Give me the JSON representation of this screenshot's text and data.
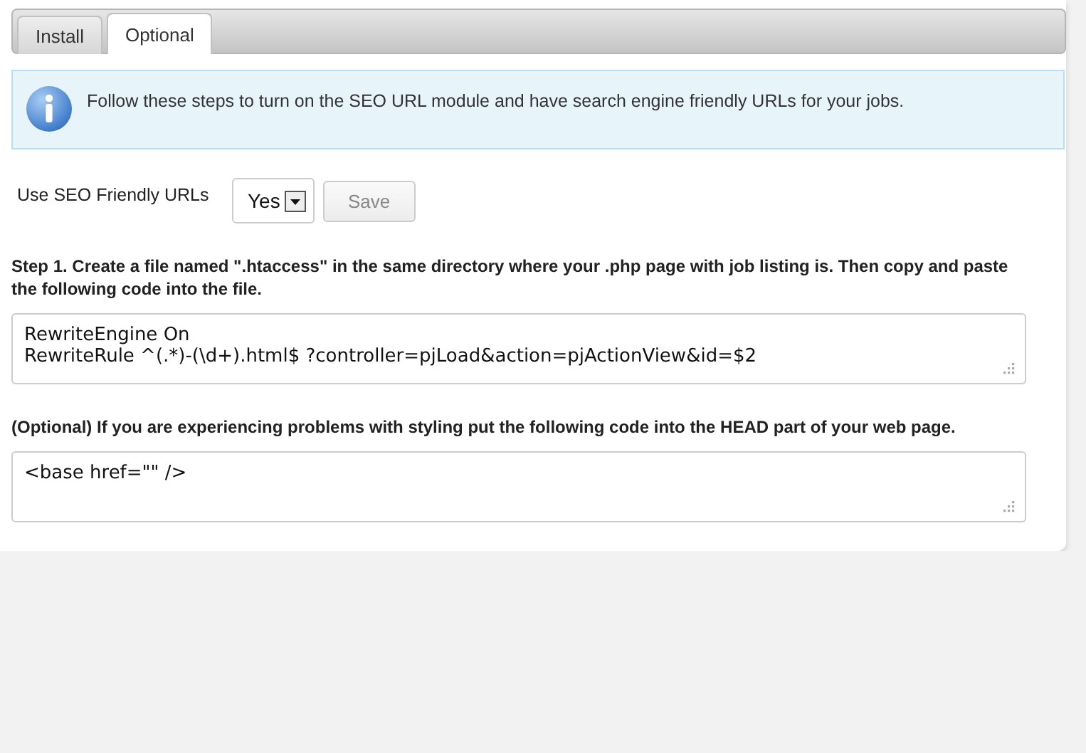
{
  "tabs": [
    {
      "label": "Install",
      "selected": false
    },
    {
      "label": "Optional",
      "selected": true
    }
  ],
  "notice": "Follow these steps to turn on the SEO URL module and have search engine friendly URLs for your jobs.",
  "seo_setting": {
    "label": "Use SEO Friendly URLs",
    "value": "Yes",
    "save_button": "Save"
  },
  "steps": [
    {
      "text": "Step 1. Create a file named \".htaccess\" in the same directory where your .php page with job listing is. Then copy and paste the following code into the file.",
      "code": "RewriteEngine On\nRewriteRule ^(.*)-(\\d+).html$ ?controller=pjLoad&action=pjActionView&id=$2"
    },
    {
      "text": "(Optional) If you are experiencing problems with styling put the following code into the HEAD part of your web page.",
      "code": "<base href=\"\" />"
    }
  ]
}
